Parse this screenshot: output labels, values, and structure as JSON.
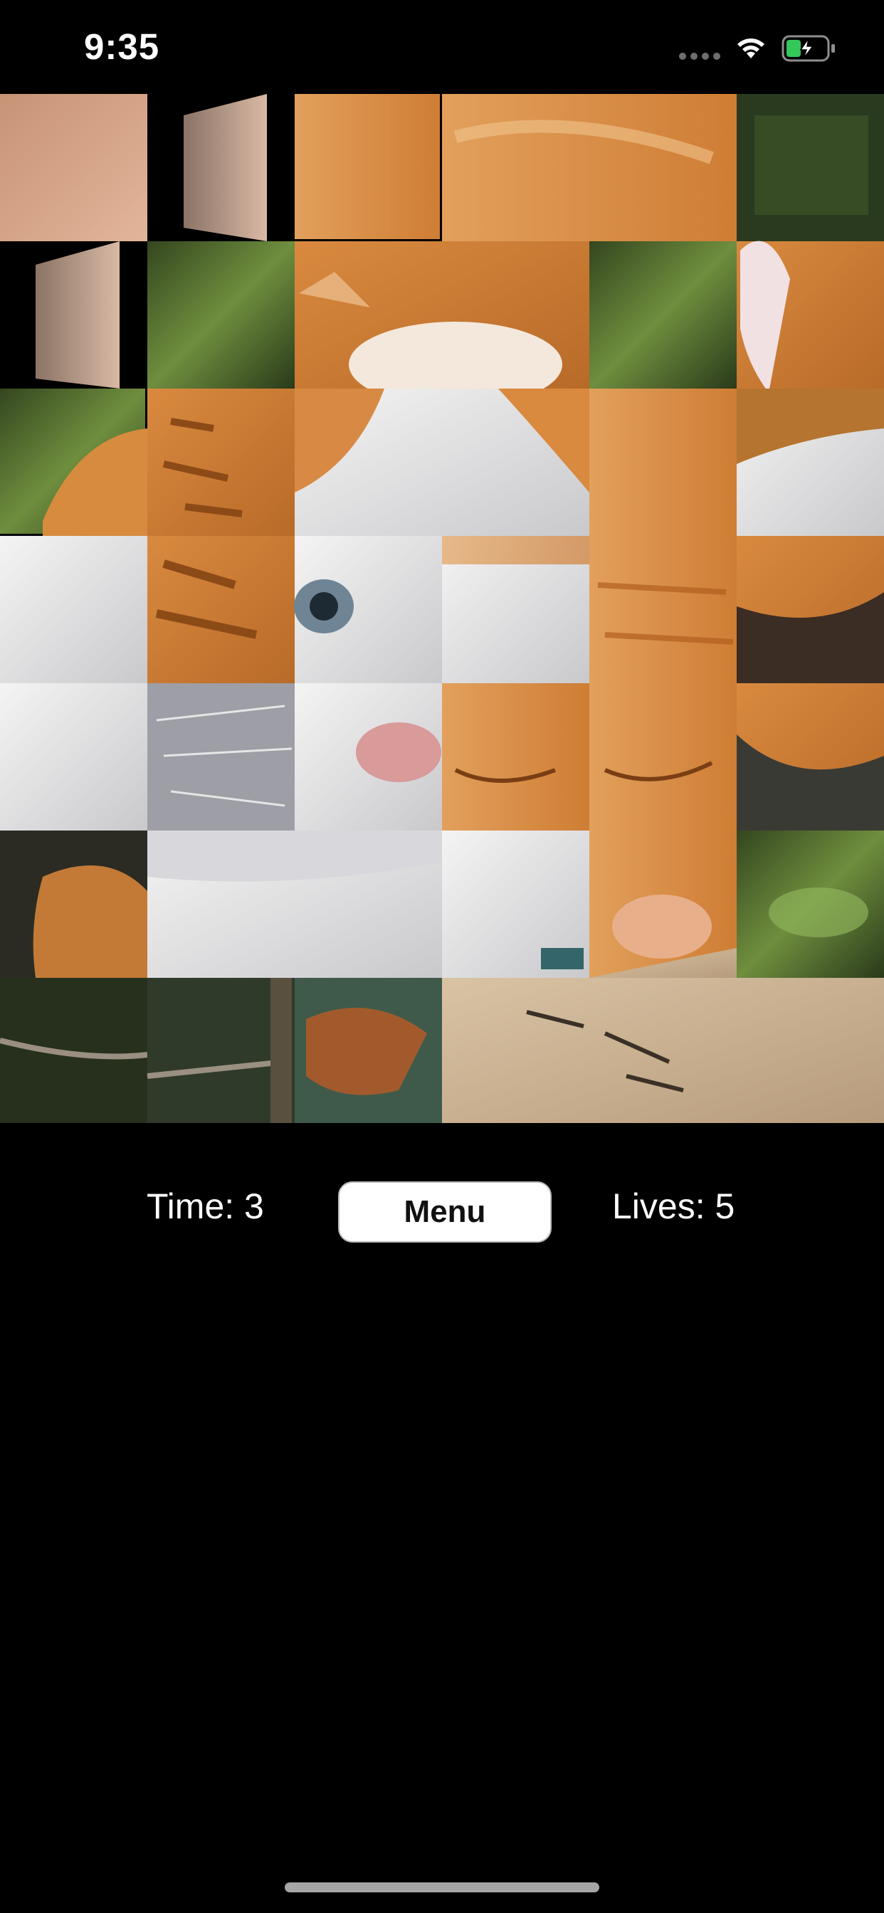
{
  "status_bar": {
    "time": "9:35",
    "icons": [
      "signal-dots-icon",
      "wifi-icon",
      "battery-charging-icon"
    ],
    "battery_color": "#34c759"
  },
  "puzzle": {
    "grid": {
      "columns": 6,
      "rows": 7
    },
    "image_subject": "kittens",
    "flipping_tiles": 3,
    "dark_tile_count": 1
  },
  "controls": {
    "time_label": "Time: 3",
    "menu_label": "Menu",
    "lives_label": "Lives:  5"
  },
  "colors": {
    "background": "#000000",
    "fur_orange": "#d4873a",
    "fur_white": "#eeeeee",
    "foliage": "#4c6b2c"
  }
}
